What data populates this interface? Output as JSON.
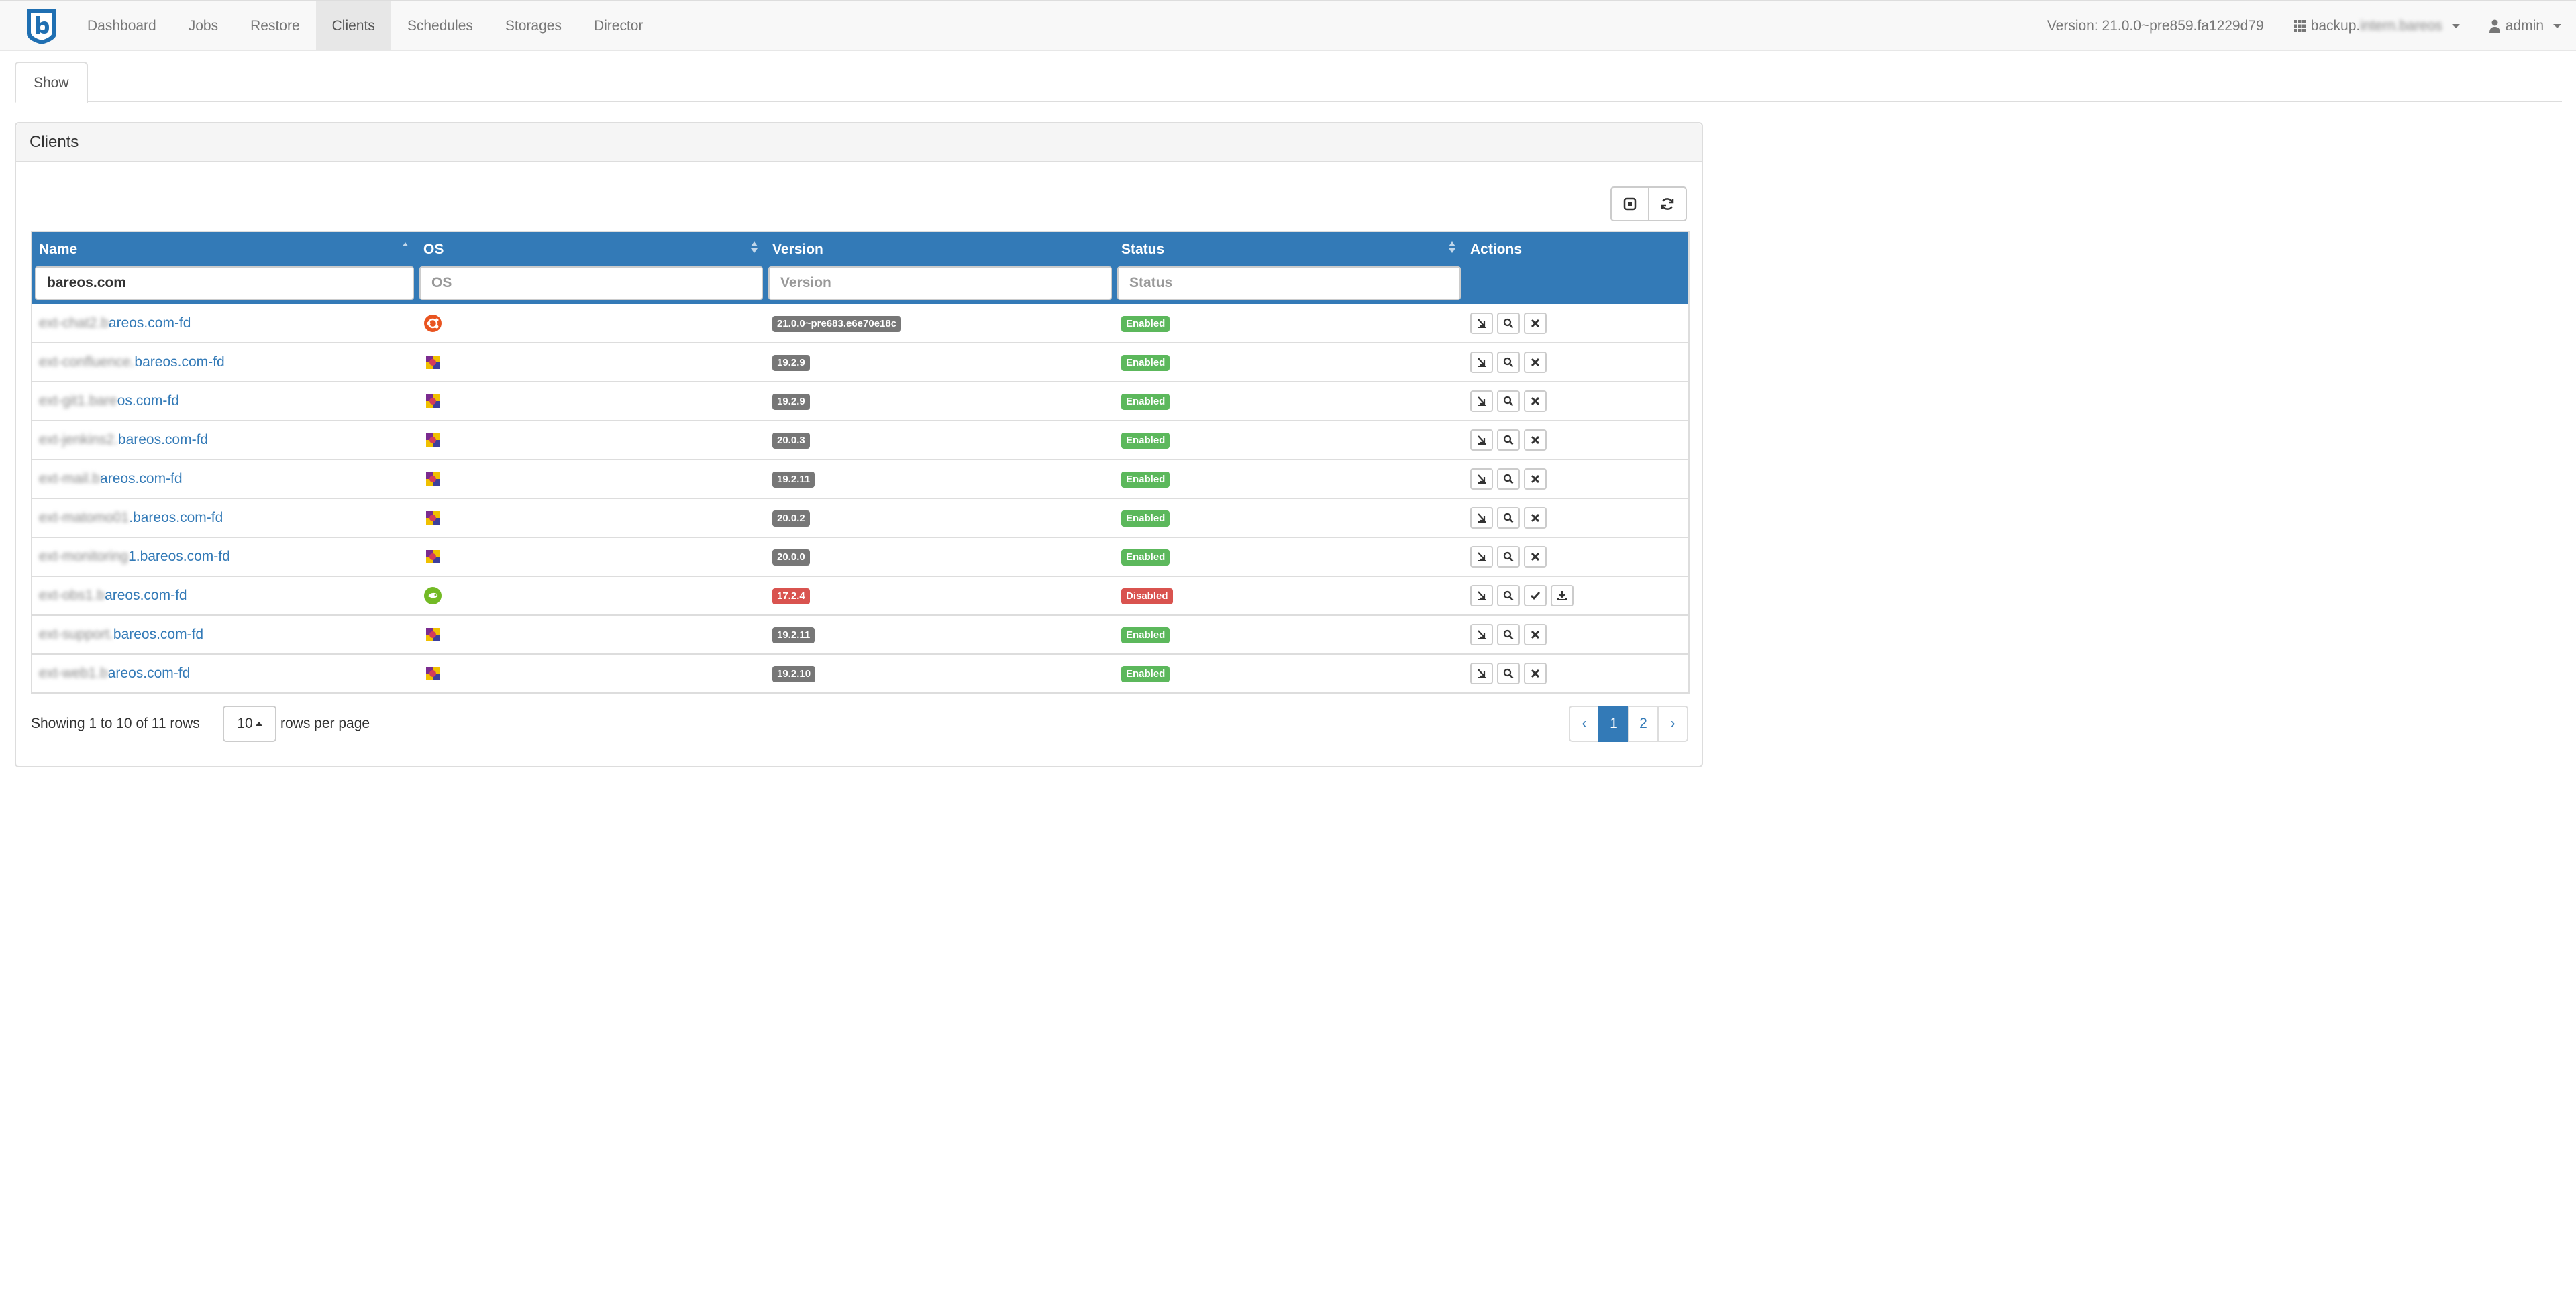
{
  "navbar": {
    "items": [
      {
        "label": "Dashboard"
      },
      {
        "label": "Jobs"
      },
      {
        "label": "Restore"
      },
      {
        "label": "Clients",
        "active": true
      },
      {
        "label": "Schedules"
      },
      {
        "label": "Storages"
      },
      {
        "label": "Director"
      }
    ],
    "version": "Version: 21.0.0~pre859.fa1229d79",
    "director_prefix": "backup.",
    "director_blurred": "intern.bareos",
    "user": "admin"
  },
  "tabs": [
    {
      "label": "Show",
      "active": true
    }
  ],
  "panel": {
    "title": "Clients"
  },
  "table": {
    "columns": [
      "Name",
      "OS",
      "Version",
      "Status",
      "Actions"
    ],
    "filters": {
      "name_value": "bareos.com",
      "os_placeholder": "OS",
      "version_placeholder": "Version",
      "status_placeholder": "Status"
    },
    "rows": [
      {
        "name_blur": "ext-chat2.b",
        "name": "areos.com-fd",
        "os": "ubuntu",
        "version": "21.0.0~pre683.e6e70e18c",
        "status": "Enabled",
        "actions": [
          "restore",
          "search",
          "disable"
        ]
      },
      {
        "name_blur": "ext-confluence.",
        "name": "bareos.com-fd",
        "os": "debian",
        "version": "19.2.9",
        "status": "Enabled",
        "actions": [
          "restore",
          "search",
          "disable"
        ]
      },
      {
        "name_blur": "ext-git1.bare",
        "name": "os.com-fd",
        "os": "debian",
        "version": "19.2.9",
        "status": "Enabled",
        "actions": [
          "restore",
          "search",
          "disable"
        ]
      },
      {
        "name_blur": "ext-jenkins2.",
        "name": "bareos.com-fd",
        "os": "debian",
        "version": "20.0.3",
        "status": "Enabled",
        "actions": [
          "restore",
          "search",
          "disable"
        ]
      },
      {
        "name_blur": "ext-mail.b",
        "name": "areos.com-fd",
        "os": "debian",
        "version": "19.2.11",
        "status": "Enabled",
        "actions": [
          "restore",
          "search",
          "disable"
        ]
      },
      {
        "name_blur": "ext-matomo01",
        "name": ".bareos.com-fd",
        "os": "debian",
        "version": "20.0.2",
        "status": "Enabled",
        "actions": [
          "restore",
          "search",
          "disable"
        ]
      },
      {
        "name_blur": "ext-monitoring",
        "name": "1.bareos.com-fd",
        "os": "debian",
        "version": "20.0.0",
        "status": "Enabled",
        "actions": [
          "restore",
          "search",
          "disable"
        ]
      },
      {
        "name_blur": "ext-obs1.b",
        "name": "areos.com-fd",
        "os": "opensuse",
        "version": "17.2.4",
        "status": "Disabled",
        "actions": [
          "restore",
          "search",
          "enable",
          "update"
        ]
      },
      {
        "name_blur": "ext-support.",
        "name": "bareos.com-fd",
        "os": "debian",
        "version": "19.2.11",
        "status": "Enabled",
        "actions": [
          "restore",
          "search",
          "disable"
        ]
      },
      {
        "name_blur": "ext-web1.b",
        "name": "areos.com-fd",
        "os": "debian",
        "version": "19.2.10",
        "status": "Enabled",
        "actions": [
          "restore",
          "search",
          "disable"
        ]
      }
    ]
  },
  "footer": {
    "showing": "Showing 1 to 10 of 11 rows",
    "rows_per_page_value": "10",
    "rows_per_page_label": "rows per page",
    "pages": [
      "‹",
      "1",
      "2",
      "›"
    ],
    "active_page": "1"
  },
  "colors": {
    "primary": "#337ab7",
    "enabled": "#5cb85c",
    "disabled": "#d9534f",
    "version_label": "#777777"
  }
}
